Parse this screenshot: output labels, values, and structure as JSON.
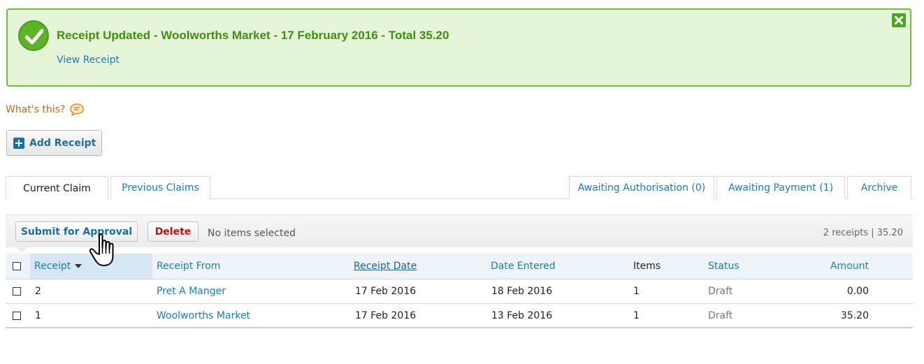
{
  "notice": {
    "title": "Receipt Updated - Woolworths Market - 17 February 2016 - Total 35.20",
    "link": "View Receipt",
    "color": "#3f8f12",
    "icons": {
      "status": "check-circle-icon",
      "close": "close-icon"
    }
  },
  "help": {
    "label": "What's this?",
    "icon": "speech-bubble-icon"
  },
  "add_button": {
    "label": "Add Receipt",
    "icon": "plus-icon"
  },
  "tabs_left": [
    {
      "label": "Current Claim",
      "active": true
    },
    {
      "label": "Previous Claims",
      "active": false
    }
  ],
  "tabs_right": [
    {
      "label": "Awaiting Authorisation (0)"
    },
    {
      "label": "Awaiting Payment (1)"
    },
    {
      "label": "Archive"
    }
  ],
  "toolbar": {
    "submit_label": "Submit for Approval",
    "delete_label": "Delete",
    "selection_status": "No items selected",
    "summary": "2 receipts | 35.20"
  },
  "table": {
    "columns": [
      "Receipt",
      "Receipt From",
      "Receipt Date",
      "Date Entered",
      "Items",
      "Status",
      "Amount"
    ],
    "rows": [
      {
        "receipt": "2",
        "from": "Pret A Manger",
        "receipt_date": "17 Feb 2016",
        "date_entered": "18 Feb 2016",
        "items": "1",
        "status": "Draft",
        "amount": "0.00"
      },
      {
        "receipt": "1",
        "from": "Woolworths Market",
        "receipt_date": "17 Feb 2016",
        "date_entered": "13 Feb 2016",
        "items": "1",
        "status": "Draft",
        "amount": "35.20"
      }
    ]
  },
  "cursor": {
    "icon": "hand-pointer-icon"
  }
}
